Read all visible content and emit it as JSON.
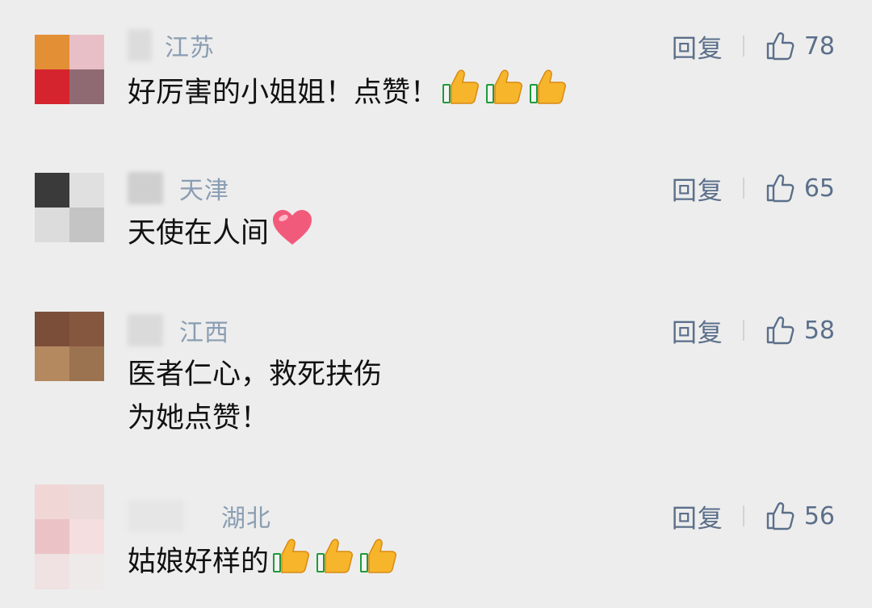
{
  "comments": [
    {
      "region": "江苏",
      "reply_label": "回复",
      "likes": "78",
      "text": "好厉害的小姐姐！点赞！",
      "emoji": [
        "thumbs-up",
        "thumbs-up",
        "thumbs-up"
      ],
      "avatar_colors": [
        "#e38f35",
        "#e8bfc6",
        "#d5242d",
        "#8f6a72"
      ],
      "name_blur_color": "#d8d8d8"
    },
    {
      "region": "天津",
      "reply_label": "回复",
      "likes": "65",
      "text": "天使在人间",
      "emoji": [
        "heart"
      ],
      "avatar_colors": [
        "#3a3a3a",
        "#e0e0e0",
        "#dcdcdc",
        "#c4c4c4"
      ],
      "name_blur_color": "#cfcfcf"
    },
    {
      "region": "江西",
      "reply_label": "回复",
      "likes": "58",
      "text_lines": [
        "医者仁心，救死扶伤",
        "为她点赞！"
      ],
      "emoji": [],
      "avatar_colors": [
        "#7b4e39",
        "#86573f",
        "#b48960",
        "#9c7350"
      ],
      "name_blur_color": "#dadada"
    },
    {
      "region": "湖北",
      "reply_label": "回复",
      "likes": "56",
      "text": "姑娘好样的",
      "emoji": [
        "thumbs-up",
        "thumbs-up",
        "thumbs-up"
      ],
      "avatar_colors": [
        "#f1d6d6",
        "#ecdada",
        "#ebc3c7",
        "#f4dedf",
        "#f0e2e2",
        "#eeeaea"
      ],
      "name_blur_color": "#e6e6e6"
    }
  ],
  "accent_color": "#5b6f8a",
  "region_color": "#8a9db2"
}
